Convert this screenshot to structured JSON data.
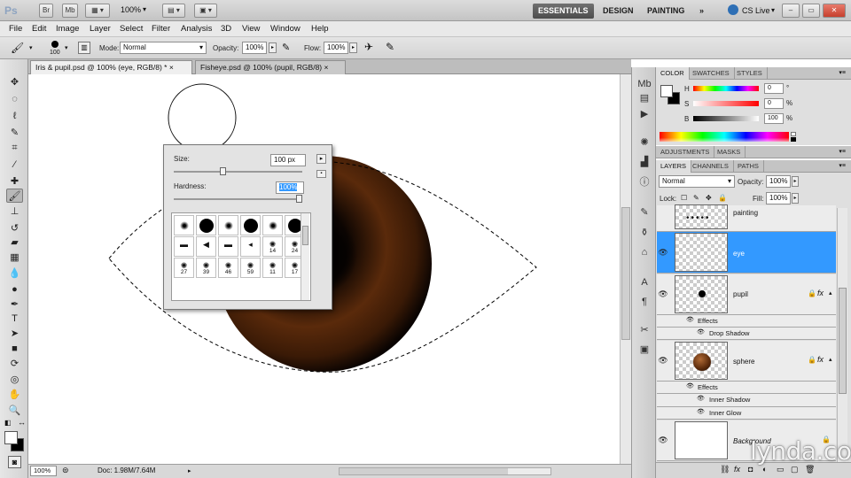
{
  "app": {
    "logo": "Ps",
    "br_label": "Br",
    "mb_label": "Mb",
    "zoom": "100%"
  },
  "workspaces": [
    "ESSENTIALS",
    "DESIGN",
    "PAINTING",
    "»"
  ],
  "cs_live": "CS Live",
  "menu": [
    "File",
    "Edit",
    "Image",
    "Layer",
    "Select",
    "Filter",
    "Analysis",
    "3D",
    "View",
    "Window",
    "Help"
  ],
  "options": {
    "brush_size": "100",
    "mode_label": "Mode:",
    "mode_value": "Normal",
    "opacity_label": "Opacity:",
    "opacity_value": "100%",
    "flow_label": "Flow:",
    "flow_value": "100%"
  },
  "doc_tabs": [
    {
      "label": "Iris & pupil.psd @ 100% (eye, RGB/8) *",
      "close": "×"
    },
    {
      "label": "Fisheye.psd @ 100% (pupil, RGB/8)",
      "close": "×"
    }
  ],
  "brush_popup": {
    "size_label": "Size:",
    "size_value": "100 px",
    "hardness_label": "Hardness:",
    "hardness_value": "100%",
    "size_level": 0.38,
    "hardness_level": 1.0,
    "presets": [
      "",
      "",
      "",
      "",
      "",
      "",
      "",
      "",
      "",
      "",
      "14",
      "24",
      "27",
      "39",
      "46",
      "59",
      "11",
      "17"
    ]
  },
  "status": {
    "zoom": "100%",
    "doc": "Doc: 1.98M/7.64M"
  },
  "color_panel": {
    "tabs": [
      "COLOR",
      "SWATCHES",
      "STYLES"
    ],
    "channels": [
      {
        "label": "H",
        "value": "0",
        "unit": "°"
      },
      {
        "label": "S",
        "value": "0",
        "unit": "%"
      },
      {
        "label": "B",
        "value": "100",
        "unit": "%"
      }
    ]
  },
  "adjust_tabs": [
    "ADJUSTMENTS",
    "MASKS"
  ],
  "layers_panel": {
    "tabs": [
      "LAYERS",
      "CHANNELS",
      "PATHS"
    ],
    "blend": "Normal",
    "opacity_label": "Opacity:",
    "opacity_value": "100%",
    "lock_label": "Lock:",
    "fill_label": "Fill:",
    "fill_value": "100%",
    "layers": [
      {
        "name": "painting"
      },
      {
        "name": "eye",
        "selected": true
      },
      {
        "name": "pupil",
        "fx": "fx",
        "effects_label": "Effects",
        "effects": [
          "Drop Shadow"
        ]
      },
      {
        "name": "sphere",
        "fx": "fx",
        "effects_label": "Effects",
        "effects": [
          "Inner Shadow",
          "Inner Glow"
        ]
      },
      {
        "name": "Background"
      }
    ]
  },
  "watermark": "lynda.com",
  "colors": {
    "accent": "#3399ff",
    "iris": "#5a2a0b"
  }
}
